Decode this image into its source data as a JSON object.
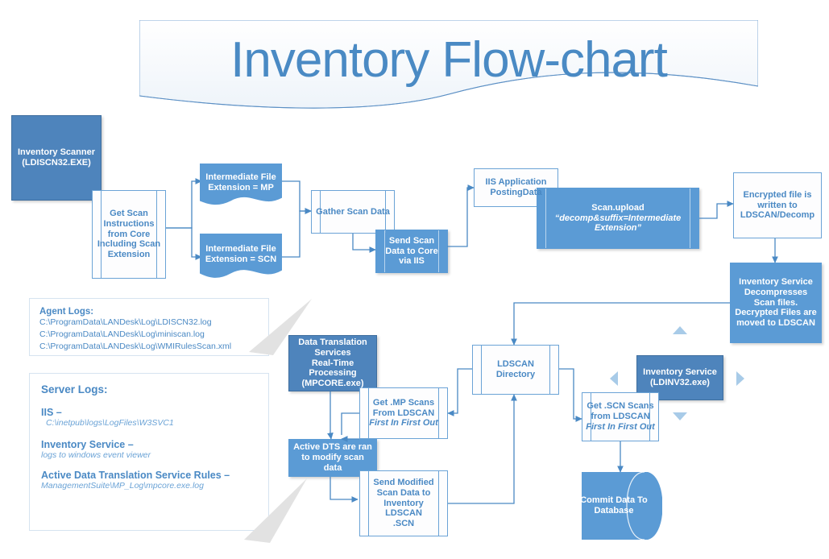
{
  "banner": {
    "title": "Inventory Flow-chart"
  },
  "colors": {
    "dark_blue": "#4e84bc",
    "mid_blue": "#5b9bd5",
    "outline_blue": "#6ba3d6",
    "text_blue": "#4a89c4",
    "handle_blue": "#a8cbe8"
  },
  "nodes": {
    "inventory_scanner": {
      "line1": "Inventory Scanner",
      "line2": "(LDISCN32.EXE)"
    },
    "get_scan_instructions": {
      "text": "Get Scan Instructions from Core Including Scan Extension"
    },
    "intermediate_mp": {
      "line1": "Intermediate File",
      "line2": "Extension = MP"
    },
    "intermediate_scn": {
      "line1": "Intermediate File",
      "line2": "Extension = SCN"
    },
    "gather_scan_data": {
      "text": "Gather Scan Data"
    },
    "send_scan_data": {
      "text": "Send Scan Data to Core via IIS"
    },
    "iis_application": {
      "line1": "IIS Application",
      "line2": "PostingData"
    },
    "scan_upload": {
      "line1": "Scan.upload",
      "line2": "“decomp&suffix=Intermediate Extension”"
    },
    "encrypted_file": {
      "text": "Encrypted file is written to LDSCAN/Decomp"
    },
    "inventory_service_decompress": {
      "text": "Inventory Service Decompresses Scan files. Decrypted Files are moved to LDSCAN"
    },
    "data_translation": {
      "line1": "Data Translation",
      "line2": "Services",
      "line3": "Real-Time Processing",
      "line4": "(MPCORE.exe)"
    },
    "get_mp_scans": {
      "line1": "Get .MP Scans",
      "line2": "From LDSCAN",
      "line3": "First In First Out"
    },
    "active_dts": {
      "text": "Active DTS are ran to modify scan data"
    },
    "send_modified": {
      "line1": "Send Modified",
      "line2": "Scan Data to",
      "line3": "Inventory",
      "line4": "LDSCAN",
      "line5": ".SCN"
    },
    "ldscan_directory": {
      "line1": "LDSCAN",
      "line2": "Directory"
    },
    "inventory_service": {
      "line1": "Inventory Service",
      "line2": "(LDINV32.exe)"
    },
    "get_scn_scans": {
      "line1": "Get .SCN Scans",
      "line2": "from LDSCAN",
      "line3": "First In First Out"
    },
    "commit_data": {
      "line1": "Commit Data To",
      "line2": "Database"
    }
  },
  "notes": {
    "agent_logs": {
      "heading": "Agent Logs:",
      "lines": [
        "C:\\ProgramData\\LANDesk\\Log\\LDISCN32.log",
        "C:\\ProgramData\\LANDesk\\Log\\miniscan.log",
        "C:\\ProgramData\\LANDesk\\Log\\WMIRulesScan.xml"
      ]
    },
    "server_logs": {
      "heading": "Server Logs:",
      "entries": [
        {
          "label": "IIS –",
          "value": "C:\\inetpub\\logs\\LogFiles\\W3SVC1"
        },
        {
          "label": "Inventory Service –",
          "value": "logs to windows event viewer"
        },
        {
          "label": "Active Data Translation Service Rules –",
          "value": "ManagementSuite\\MP_Log\\mpcore.exe.log"
        }
      ]
    }
  }
}
